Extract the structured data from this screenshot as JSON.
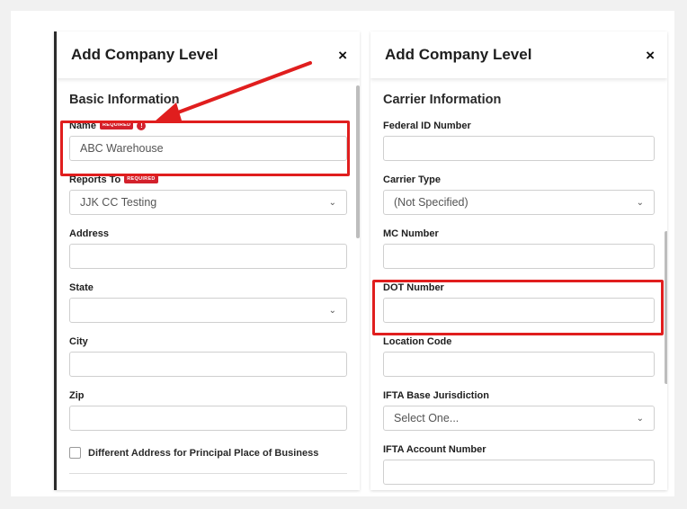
{
  "left_panel": {
    "title": "Add Company Level",
    "close_glyph": "×",
    "section_title": "Basic Information",
    "required_badge": "REQUIRED",
    "alert_glyph": "!",
    "fields": {
      "name": {
        "label": "Name",
        "value": "ABC Warehouse"
      },
      "reports_to": {
        "label": "Reports To",
        "value": "JJK CC Testing"
      },
      "address": {
        "label": "Address",
        "value": ""
      },
      "state": {
        "label": "State",
        "value": ""
      },
      "city": {
        "label": "City",
        "value": ""
      },
      "zip": {
        "label": "Zip",
        "value": ""
      }
    },
    "checkbox_label": "Different Address for Principal Place of Business"
  },
  "right_panel": {
    "title": "Add Company Level",
    "close_glyph": "×",
    "section_title": "Carrier Information",
    "fields": {
      "federal_id": {
        "label": "Federal ID Number",
        "value": ""
      },
      "carrier_type": {
        "label": "Carrier Type",
        "value": "(Not Specified)"
      },
      "mc_number": {
        "label": "MC Number",
        "value": ""
      },
      "dot_number": {
        "label": "DOT Number",
        "value": ""
      },
      "location_code": {
        "label": "Location Code",
        "value": ""
      },
      "ifta_base": {
        "label": "IFTA Base Jurisdiction",
        "value": "Select One..."
      },
      "ifta_account": {
        "label": "IFTA Account Number",
        "value": ""
      }
    }
  },
  "icons": {
    "close": "close-icon",
    "chevron": "chevron-down-icon",
    "alert": "alert-icon",
    "arrow": "red-arrow-annotation"
  },
  "colors": {
    "highlight": "#e01e1e",
    "required_badge": "#d3212c",
    "title_text": "#1e1e1e"
  }
}
